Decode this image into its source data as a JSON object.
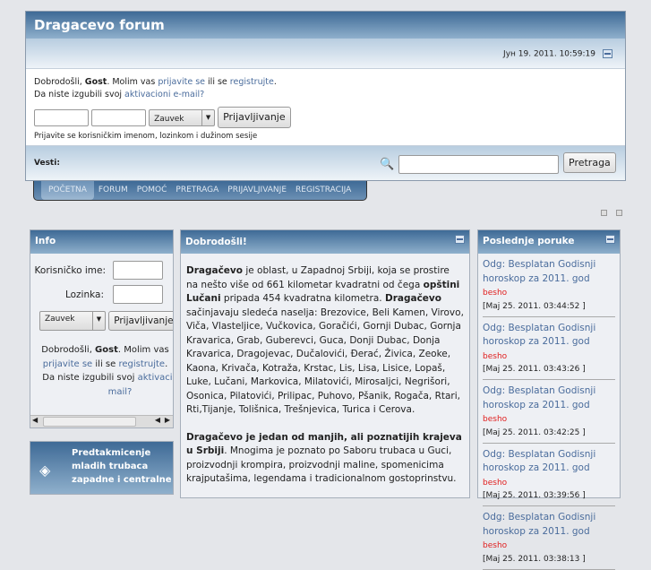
{
  "header": {
    "title": "Dragacevo forum",
    "date": "Јун 19. 2011. 10:59:19"
  },
  "login": {
    "welcome_prefix": "Dobrodošli, ",
    "user": "Gost",
    "welcome_mid": ". Molim vas ",
    "login_link": "prijavite se",
    "or": " ili se ",
    "register_link": "registrujte",
    "dot": ".",
    "lost_prefix": "Da niste izgubili svoj ",
    "activation_link": "aktivacioni e-mail?",
    "duration": "Zauvek",
    "login_button": "Prijavljivanje",
    "hint": "Prijavite se korisničkim imenom, lozinkom i dužinom sesije"
  },
  "news": {
    "label": "Vesti:",
    "search_button": "Pretraga"
  },
  "nav": [
    "POČETNA",
    "FORUM",
    "POMOĆ",
    "PRETRAGA",
    "PRIJAVLJIVANJE",
    "REGISTRACIJA"
  ],
  "info": {
    "title": "Info",
    "username_label": "Korisničko ime:",
    "password_label": "Lozinka:",
    "duration": "Zauvek",
    "login_button": "Prijavljivanje",
    "welcome_prefix": "Dobrodošli, ",
    "user": "Gost",
    "welcome_mid": ". Molim vas ",
    "login_link": "prijavite se",
    "or": " ili se ",
    "register_link": "registrujte",
    "dot": ".",
    "lost_prefix": "Da niste izgubili svoj ",
    "activation_link": "aktivacioni e-mail?"
  },
  "promo": {
    "text": "Predtakmicenje mladih trubaca zapadne i centralne"
  },
  "welcome": {
    "title": "Dobrodošli!",
    "p1_b1": "Dragačevo",
    "p1_t1": " je oblast, u Zapadnoj Srbiji, koja se prostire na nešto više od 661 kilometar kvadratni od čega ",
    "p1_b2": "opštini Lučani",
    "p1_t2": " pripada 454 kvadratna kilometra. ",
    "p1_b3": "Dragačevo",
    "p1_t3": " sačinjavaju sledeća naselja: Brezovice, Beli Kamen, Virovo, Viča, Vlasteljice, Vučkovica, Goračići, Gornji Dubac, Gornja Kravarica, Grab, Guberevci, Guca, Donji Dubac, Donja Kravarica, Dragojevac, Dučalovići, Đerać, Živica, Zeoke, Kaona, Krivača, Kotraža, Krstac, Lis, Lisa, Lisice, Lopaš, Luke, Lučani, Markovica, Milatovići, Mirosaljci, Negrišori, Osonica, Pilatovići, Prilipac, Puhovo, Pšanik, Rogača, Rtari, Rti,Tijanje, Tolišnica, Trešnjevica, Turica i Cerova.",
    "p2_b": "Dragačevo je jedan od manjih, ali poznatijih krajeva u Srbiji",
    "p2_t": ". Mnogima je poznato po Saboru trubaca u Guci, proizvodnji krompira, proizvodnji maline, spomenicima krajputašima, legendama i tradicionalnom gostoprinstvu."
  },
  "recent": {
    "title": "Poslednje poruke",
    "posts": [
      {
        "subject": "Odg: Besplatan Godisnji horoskop za 2011. god",
        "author": "besho",
        "time": "[Maj 25. 2011. 03:44:52 ]"
      },
      {
        "subject": "Odg: Besplatan Godisnji horoskop za 2011. god",
        "author": "besho",
        "time": "[Maj 25. 2011. 03:43:26 ]"
      },
      {
        "subject": "Odg: Besplatan Godisnji horoskop za 2011. god",
        "author": "besho",
        "time": "[Maj 25. 2011. 03:42:25 ]"
      },
      {
        "subject": "Odg: Besplatan Godisnji horoskop za 2011. god",
        "author": "besho",
        "time": "[Maj 25. 2011. 03:39:56 ]"
      },
      {
        "subject": "Odg: Besplatan Godisnji horoskop za 2011. god",
        "author": "besho",
        "time": "[Maj 25. 2011. 03:38:13 ]"
      }
    ]
  }
}
